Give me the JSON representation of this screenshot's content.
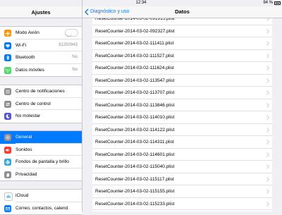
{
  "status": {
    "device": "iPad",
    "time": "12:34",
    "battery": "94 %"
  },
  "sidebar": {
    "title": "Ajustes",
    "groups": [
      [
        {
          "label": "Modo Avión",
          "icon": "airplane-icon",
          "color": "#ff9500",
          "toggle": false
        },
        {
          "label": "Wi-Fi",
          "icon": "wifi-icon",
          "color": "#007aff",
          "value": "81250943"
        },
        {
          "label": "Bluetooth",
          "icon": "bluetooth-icon",
          "color": "#007aff",
          "value": "No"
        },
        {
          "label": "Datos móviles",
          "icon": "antenna-icon",
          "color": "#4cd964",
          "value": "No"
        }
      ],
      [
        {
          "label": "Centro de notificaciones",
          "icon": "notifications-icon",
          "color": "#8e8e93"
        },
        {
          "label": "Centro de control",
          "icon": "control-center-icon",
          "color": "#8e8e93"
        },
        {
          "label": "No molestar",
          "icon": "moon-icon",
          "color": "#5856d6"
        }
      ],
      [
        {
          "label": "General",
          "icon": "gear-icon",
          "color": "#8e8e93",
          "selected": true
        },
        {
          "label": "Sonidos",
          "icon": "speaker-icon",
          "color": "#ff3b30"
        },
        {
          "label": "Fondos de pantalla y brillo",
          "icon": "flower-icon",
          "color": "#34aadc"
        },
        {
          "label": "Privacidad",
          "icon": "hand-icon",
          "color": "#8e8e93"
        }
      ],
      [
        {
          "label": "iCloud",
          "icon": "cloud-icon",
          "color": "#ffffff"
        },
        {
          "label": "Correo, contactos, calend.",
          "icon": "mail-icon",
          "color": "#007aff"
        }
      ]
    ]
  },
  "navbar": {
    "back_label": "Diagnóstico y uso",
    "title": "Datos"
  },
  "files": [
    "ResetCounter-2014-03-02-091915.plist",
    "ResetCounter-2014-03-02-092327.plist",
    "ResetCounter-2014-03-02-111411.plist",
    "ResetCounter-2014-03-02-111527.plist",
    "ResetCounter-2014-03-02-111624.plist",
    "ResetCounter-2014-03-02-113547.plist",
    "ResetCounter-2014-03-02-113707.plist",
    "ResetCounter-2014-03-02-113846.plist",
    "ResetCounter-2014-03-02-114010.plist",
    "ResetCounter-2014-03-02-114122.plist",
    "ResetCounter-2014-03-02-114311.plist",
    "ResetCounter-2014-03-02-114601.plist",
    "ResetCounter-2014-03-02-115040.plist",
    "ResetCounter-2014-03-02-115117.plist",
    "ResetCounter-2014-03-02-115155.plist",
    "ResetCounter-2014-03-02-115233.plist",
    "ResetCounter-2014-03-02-115309.plist"
  ]
}
